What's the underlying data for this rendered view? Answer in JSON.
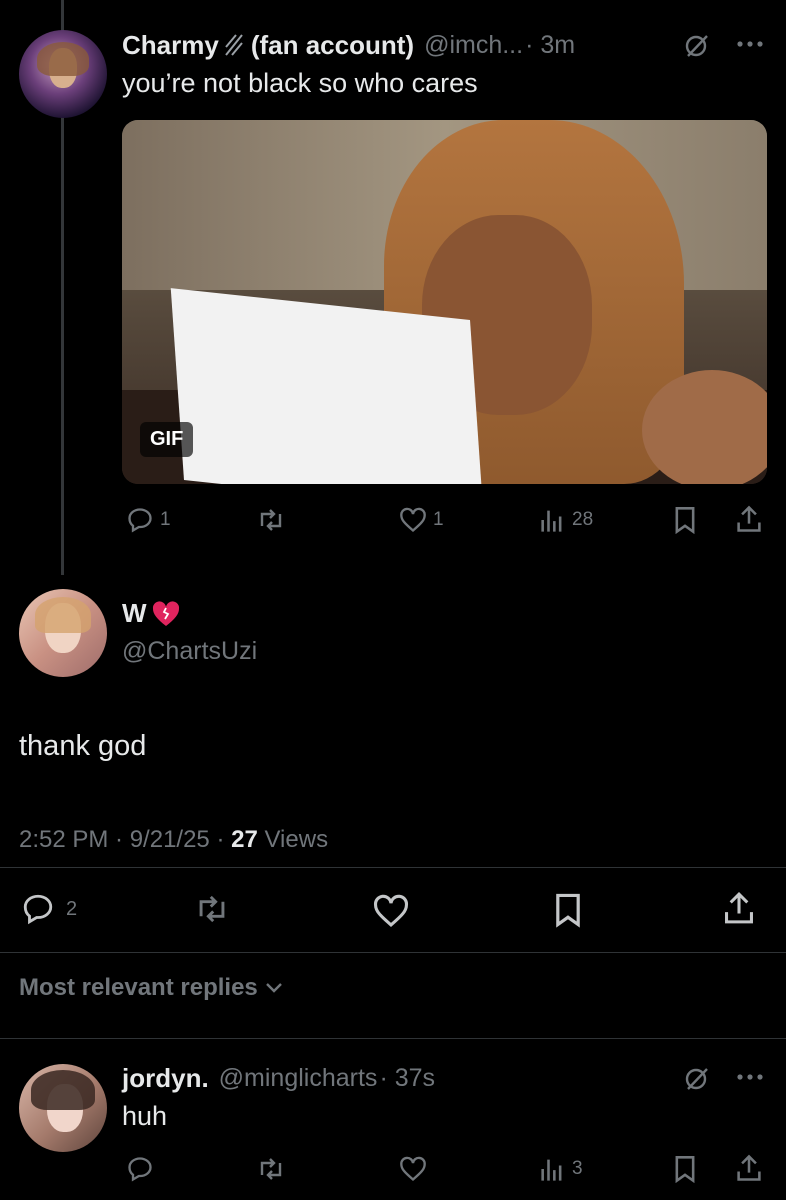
{
  "quoted_tweet": {
    "display_name": "Charmy",
    "name_suffix": "(fan account)",
    "handle": "@imch...",
    "time": "· 3m",
    "text": "you’re not black so who cares",
    "media_badge": "GIF",
    "reply_count": "1",
    "like_count": "1",
    "view_count": "28"
  },
  "main_tweet": {
    "display_name": "W",
    "handle": "@ChartsUzi",
    "text": "thank god",
    "timestamp": "2:52 PM · 9/21/25 · ",
    "views_count": "27",
    "views_label": "Views",
    "reply_count": "2"
  },
  "sort": {
    "label": "Most relevant replies"
  },
  "reply": {
    "display_name": "jordyn.",
    "handle": "@minglicharts",
    "time": "· 37s",
    "text": "huh",
    "view_count": "3"
  },
  "colors": {
    "background": "#000000",
    "text": "#e7e9ea",
    "secondary": "#71767b",
    "heart": "#e0245e"
  }
}
